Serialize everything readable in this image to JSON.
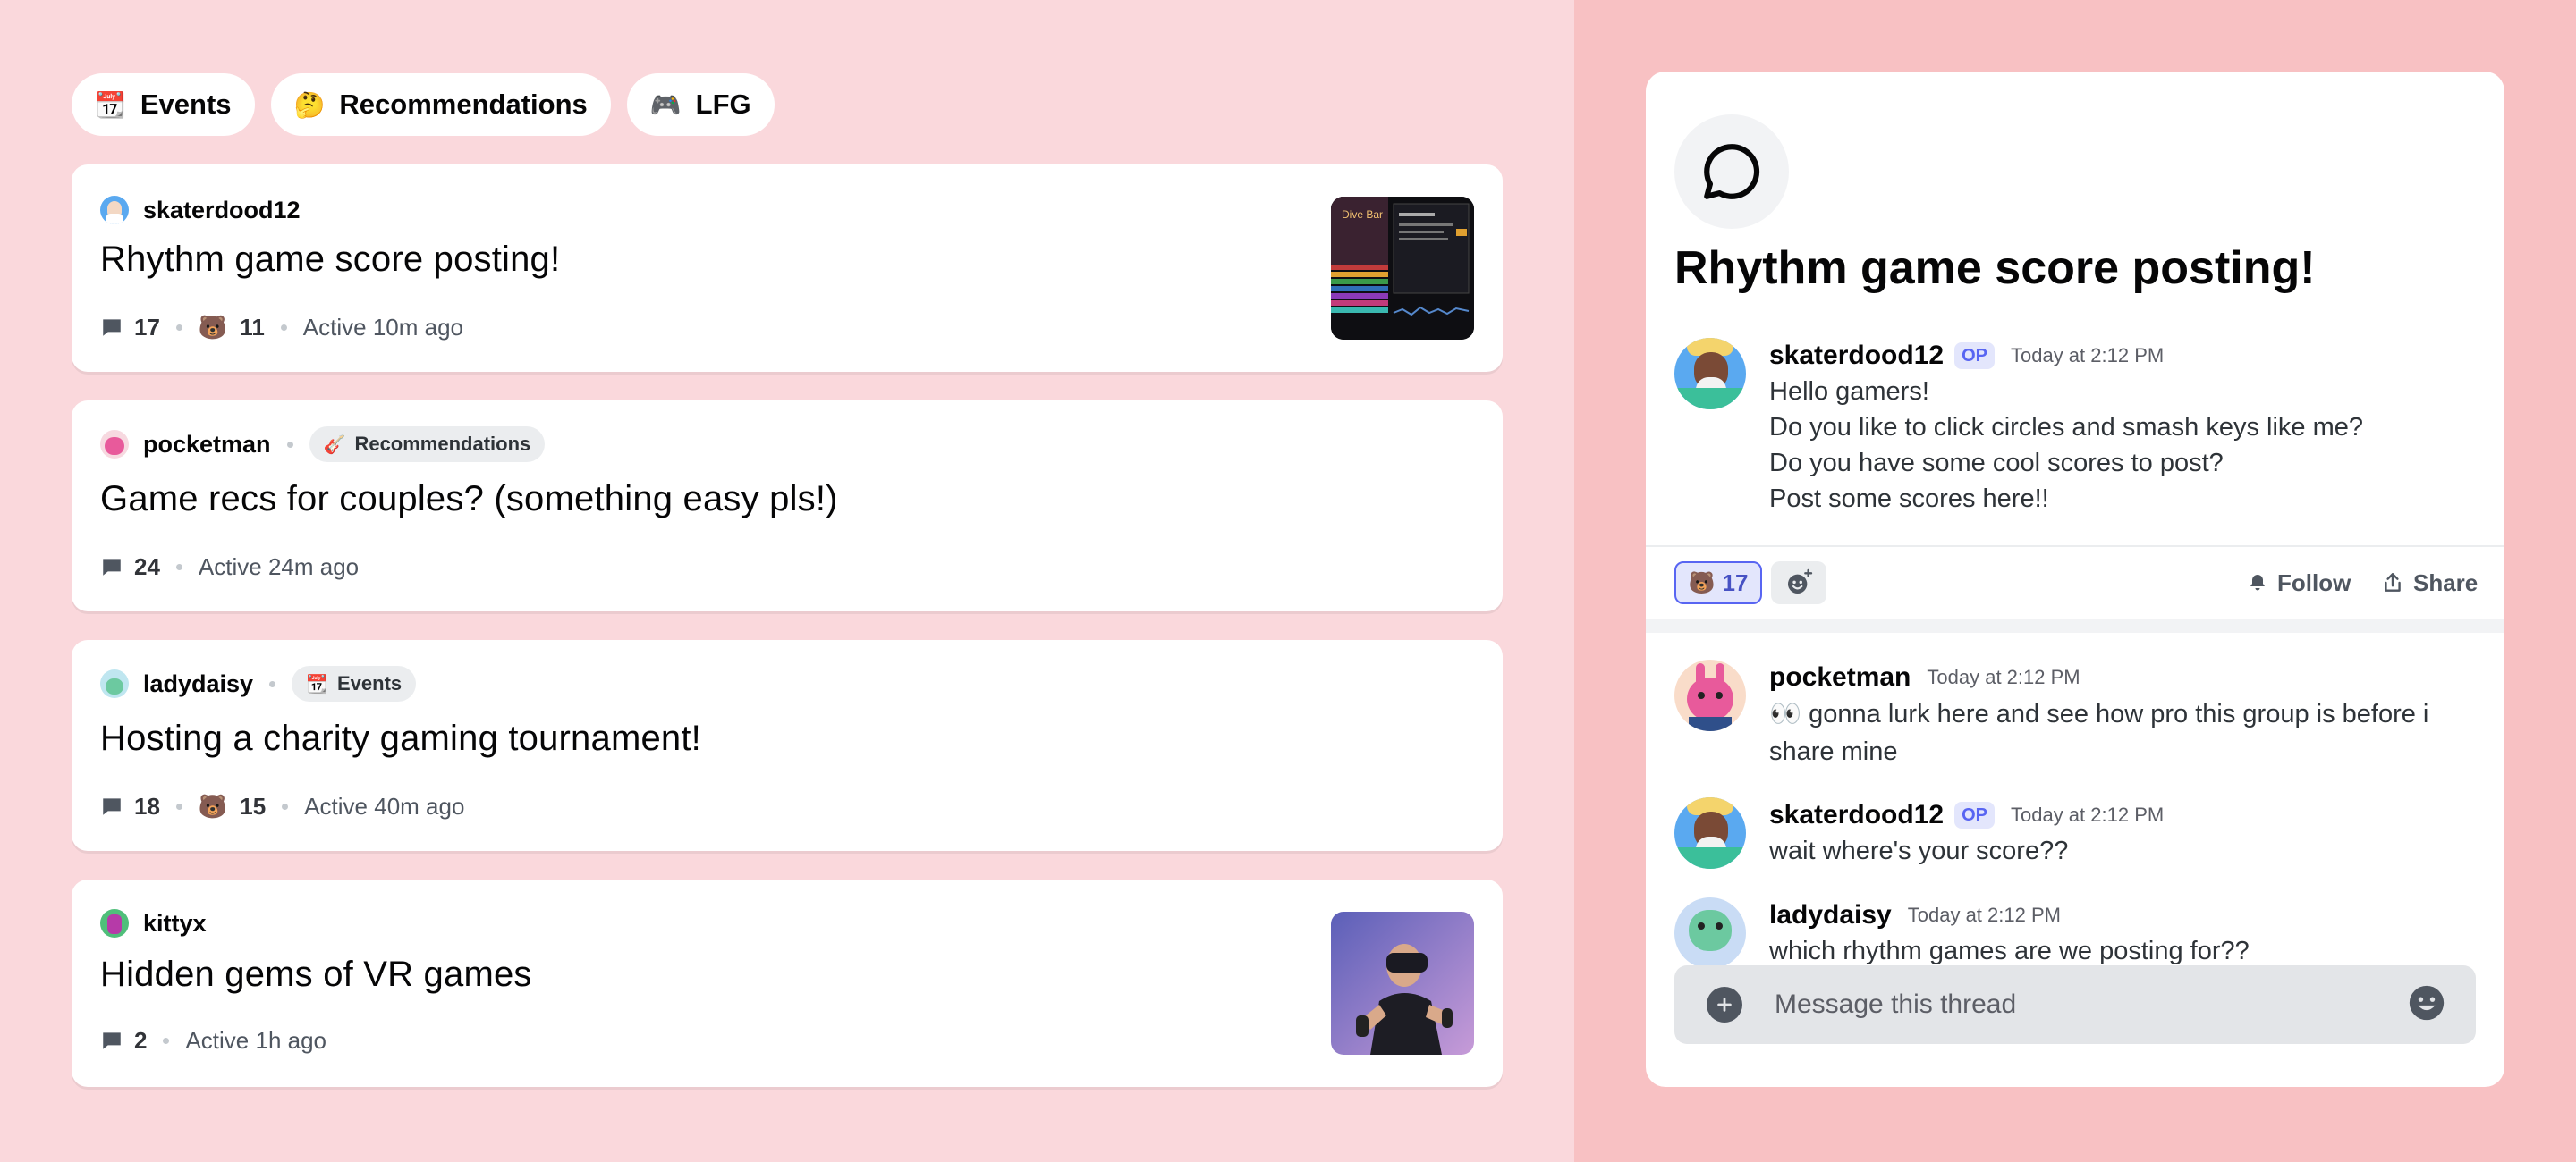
{
  "tags": [
    {
      "emoji": "📆",
      "label": "Events"
    },
    {
      "emoji": "🤔",
      "label": "Recommendations"
    },
    {
      "emoji": "🎮",
      "label": "LFG"
    }
  ],
  "posts": [
    {
      "author": "skaterdood12",
      "title": "Rhythm game score posting!",
      "comments": "17",
      "reaction_emoji": "🐻",
      "reactions": "11",
      "active": "Active 10m ago",
      "thumbnail": "score-screenshot"
    },
    {
      "author": "pocketman",
      "tag_emoji": "🎸",
      "tag": "Recommendations",
      "title": "Game recs for couples? (something easy pls!)",
      "comments": "24",
      "active": "Active 24m ago"
    },
    {
      "author": "ladydaisy",
      "tag_emoji": "📆",
      "tag": "Events",
      "title": "Hosting a charity gaming tournament!",
      "comments": "18",
      "reaction_emoji": "🐻",
      "reactions": "15",
      "active": "Active 40m ago"
    },
    {
      "author": "kittyx",
      "title": "Hidden gems of VR games",
      "comments": "2",
      "active": "Active 1h ago",
      "thumbnail": "vr-player-photo"
    }
  ],
  "thread": {
    "icon": "chat-bubble-icon",
    "title": "Rhythm game score posting!",
    "op_message": {
      "author": "skaterdood12",
      "badge": "OP",
      "time": "Today at 2:12 PM",
      "lines": [
        "Hello gamers!",
        "Do you like to click circles and smash keys like me?",
        "Do you have some cool scores to post?",
        "Post some scores here!!"
      ]
    },
    "reaction": {
      "emoji": "🐻",
      "count": "17"
    },
    "follow_label": "Follow",
    "share_label": "Share",
    "replies": [
      {
        "author": "pocketman",
        "time": "Today at 2:12 PM",
        "lines": [
          "👀 gonna lurk here and see how pro this group is before i",
          "share mine"
        ]
      },
      {
        "author": "skaterdood12",
        "badge": "OP",
        "time": "Today at 2:12 PM",
        "lines": [
          "wait where's your score??"
        ]
      },
      {
        "author": "ladydaisy",
        "time": "Today at 2:12 PM",
        "lines": [
          "which rhythm games are we posting for??"
        ]
      }
    ],
    "composer_placeholder": "Message this thread"
  },
  "colors": {
    "left_bg": "#fad8dc",
    "right_bg": "#f8c1c3",
    "accent": "#5865f2",
    "op_badge_bg": "#e3e6fc"
  }
}
